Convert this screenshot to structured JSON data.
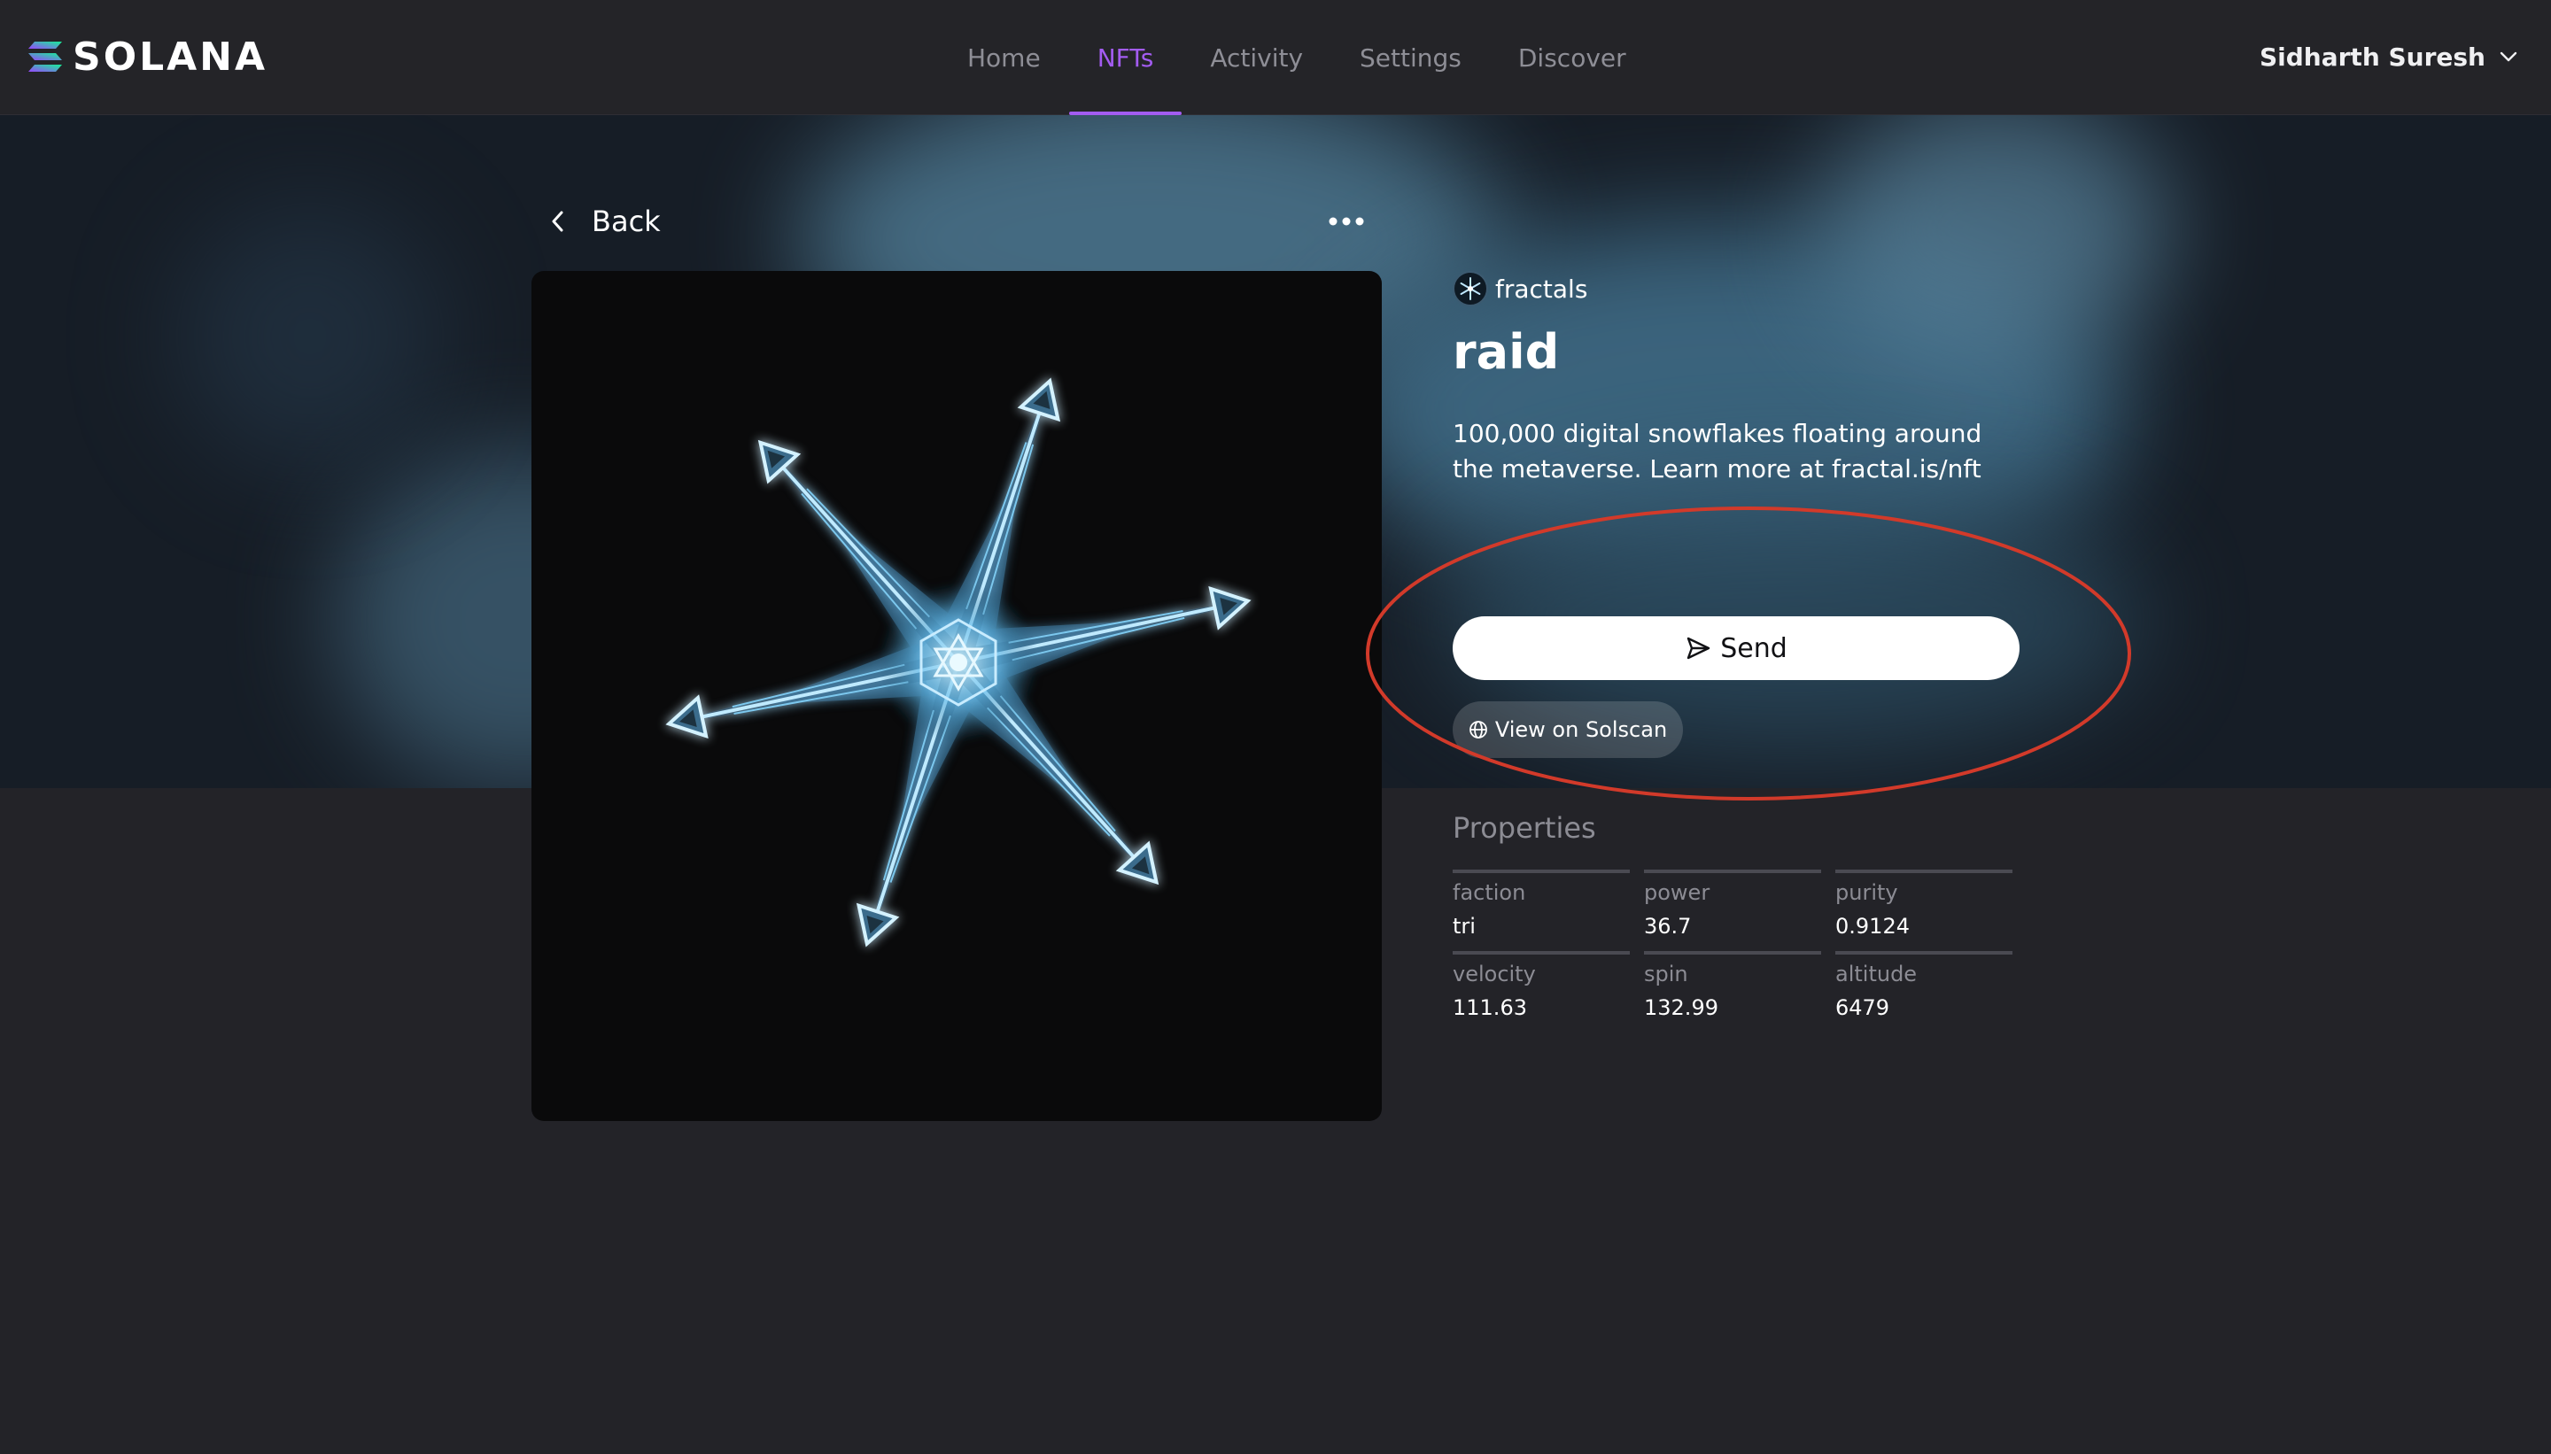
{
  "brand": {
    "name": "SOLANA",
    "logo_icon": "solana-logo-icon"
  },
  "nav": {
    "items": [
      {
        "label": "Home",
        "active": false
      },
      {
        "label": "NFTs",
        "active": true
      },
      {
        "label": "Activity",
        "active": false
      },
      {
        "label": "Settings",
        "active": false
      },
      {
        "label": "Discover",
        "active": false
      }
    ]
  },
  "user": {
    "name": "Sidharth Suresh",
    "icon": "chevron-down-icon"
  },
  "page": {
    "back_label": "Back",
    "more_icon": "more-horizontal-icon"
  },
  "nft": {
    "collection": "fractals",
    "title": "raid",
    "description": "100,000 digital snowflakes floating around the metaverse. Learn more at fractal.is/nft",
    "image_icon": "snowflake-fractal-image"
  },
  "actions": {
    "send_label": "Send",
    "send_icon": "send-icon",
    "solscan_label": "View on Solscan",
    "solscan_icon": "globe-icon"
  },
  "properties": {
    "title": "Properties",
    "items": [
      {
        "key": "faction",
        "value": "tri"
      },
      {
        "key": "power",
        "value": "36.7"
      },
      {
        "key": "purity",
        "value": "0.9124"
      },
      {
        "key": "velocity",
        "value": "111.63"
      },
      {
        "key": "spin",
        "value": "132.99"
      },
      {
        "key": "altitude",
        "value": "6479"
      }
    ]
  },
  "colors": {
    "accent": "#a35cf1",
    "background": "#232328",
    "header": "#242428",
    "annotation": "#d23a2a"
  }
}
